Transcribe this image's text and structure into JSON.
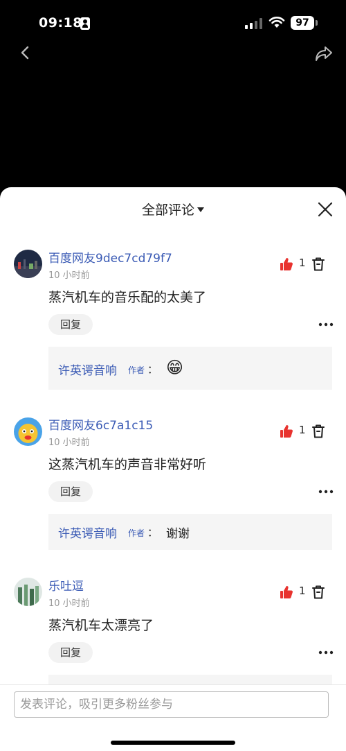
{
  "status_bar": {
    "time": "09:18",
    "battery": "97"
  },
  "sheet": {
    "title": "全部评论"
  },
  "comments": [
    {
      "user": "百度网友9dec7cd79f7",
      "time": "10 小时前",
      "text": "蒸汽机车的音乐配的太美了",
      "likes": "1",
      "reply_label": "回复",
      "reply": {
        "author": "许英谔音响",
        "tag": "作者",
        "colon": "：",
        "content": "😁"
      }
    },
    {
      "user": "百度网友6c7a1c15",
      "time": "10 小时前",
      "text": "这蒸汽机车的声音非常好听",
      "likes": "1",
      "reply_label": "回复",
      "reply": {
        "author": "许英谔音响",
        "tag": "作者",
        "colon": "：",
        "content": "谢谢"
      }
    },
    {
      "user": "乐吐逗",
      "time": "10 小时前",
      "text": "蒸汽机车太漂亮了",
      "likes": "1",
      "reply_label": "回复"
    }
  ],
  "input": {
    "placeholder": "发表评论，吸引更多粉丝参与"
  },
  "colors": {
    "like_red": "#e8322e",
    "name_blue": "#3b5bb5"
  }
}
